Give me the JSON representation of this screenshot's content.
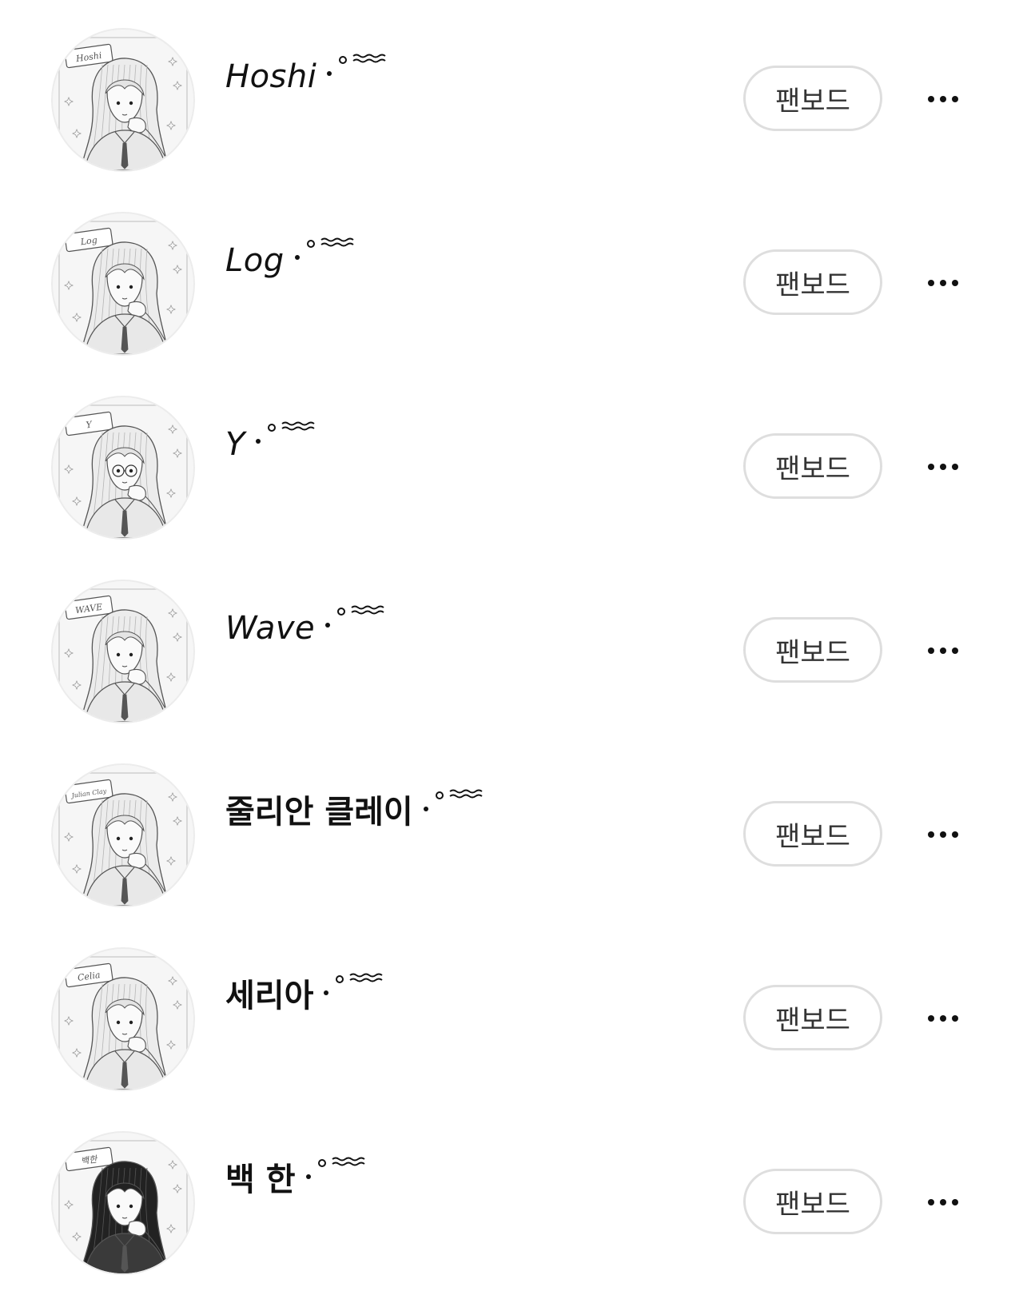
{
  "colors": {
    "background": "#ffffff",
    "text": "#111111",
    "button_border": "#dedede",
    "button_text": "#333333",
    "avatar_sketch": "#555555"
  },
  "characters": [
    {
      "name": "Hoshi",
      "style": "italic",
      "avatar_tag": "Hoshi",
      "fanboard_label": "팬보드",
      "more_icon": "more-horizontal-icon"
    },
    {
      "name": "Log",
      "style": "italic",
      "avatar_tag": "Log",
      "fanboard_label": "팬보드",
      "more_icon": "more-horizontal-icon"
    },
    {
      "name": "Y",
      "style": "italic",
      "avatar_tag": "Y",
      "fanboard_label": "팬보드",
      "more_icon": "more-horizontal-icon"
    },
    {
      "name": "Wave",
      "style": "italic",
      "avatar_tag": "WAVE",
      "fanboard_label": "팬보드",
      "more_icon": "more-horizontal-icon"
    },
    {
      "name": "줄리안 클레이",
      "style": "bold",
      "avatar_tag": "Julian Clay",
      "fanboard_label": "팬보드",
      "more_icon": "more-horizontal-icon"
    },
    {
      "name": "세리아",
      "style": "bold",
      "avatar_tag": "Celia",
      "fanboard_label": "팬보드",
      "more_icon": "more-horizontal-icon"
    },
    {
      "name": "백 한",
      "style": "bold",
      "avatar_tag": "백한",
      "fanboard_label": "팬보드",
      "more_icon": "more-horizontal-icon"
    }
  ]
}
